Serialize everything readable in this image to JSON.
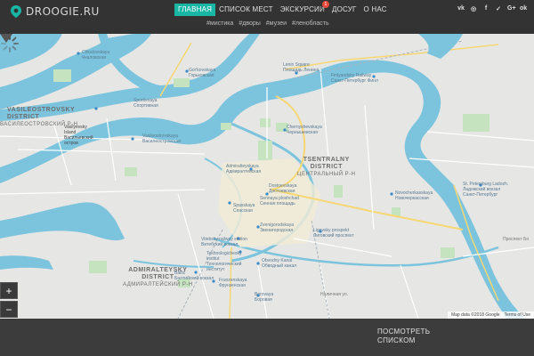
{
  "brand": {
    "name": "DROOGIE.RU",
    "accent": "#19b6a6"
  },
  "nav": {
    "items": [
      {
        "label": "ГЛАВНАЯ",
        "active": true
      },
      {
        "label": "СПИСОК МЕСТ",
        "active": false
      },
      {
        "label": "ЭКСКУРСИИ",
        "active": false,
        "badge": "1"
      },
      {
        "label": "ДОСУГ",
        "active": false
      },
      {
        "label": "О НАС",
        "active": false
      }
    ]
  },
  "tags": [
    "#мистика",
    "#дворы",
    "#музеи",
    "#ленобласть"
  ],
  "social": [
    "vk-icon",
    "instagram-icon",
    "facebook-icon",
    "twitter-icon",
    "google-plus-icon",
    "odnoklassniki-icon"
  ],
  "social_glyphs": [
    "vk",
    "◎",
    "f",
    "✓",
    "G+",
    "ok"
  ],
  "map": {
    "labels": {
      "chkalovskaya": "Chkalovskaya\nЧкаловская",
      "gorkovskaya": "Gor'kovskaya\nГорьковская",
      "lenin_square": "Lenin Square\nПлощадь Ленина",
      "finlyandsky": "Finlyandsky Railway\nСанкт-Петербург Финл",
      "sportivnaya": "Sportivnaya\nСпортивная",
      "vasileostrovsky_district": "VASILEOSTROVSKY\nDISTRICT",
      "vasileostrovsky_district_ru": "ВАСИЛЕОСТРОВСКИЙ Р-Н",
      "vasilyevsky_island": "Vasilyevsky\nIsland\nВасильевский\nостров",
      "vasileostrovskaya": "Vasileostrovskaya\nВасилеостровская",
      "chernyshevskaya": "Chernyshevskaya\nЧернышевская",
      "admiralteyskaya": "Admiralteyskaya\nАдмиралтейская",
      "dostoevskaya": "Dostoevskaya\nДостоевская",
      "sennaya": "Sennaya ploshchad\nСенная площадь",
      "tsentralny_district": "TSENTRALNY\nDISTRICT",
      "tsentralny_district_ru": "ЦЕНТРАЛЬНЫЙ Р-Н",
      "spasskaya": "Spasskaya\nСпасская",
      "zvenigorodskaya": "Zvenigorodskaya\nЗвенигородская",
      "vitebsky": "Vitebsky railway station\nВитебский вокзал",
      "tekhnologichesky": "Tekhnologichesky\ninstitut\nТехнологический\nинститут",
      "ligovsky": "Ligovsky prospekt\nЛиговский проспект",
      "obvodny": "Obvodny Kanal\nОбводный канал",
      "admiralteysky_district": "ADMIRALTEYSKY\nDISTRICT",
      "admiralteysky_district_ru": "АДМИРАЛТЕЙСКИЙ Р-Н",
      "baltic": "Baltic\nБалтийский вокзал",
      "frunzenskaya": "Frunzenskaya\nФрунзенская",
      "borovaya": "Borovaya\nБоровая",
      "novocherkasskaya": "Novocherkasskaya\nНовочеркасская",
      "ladozhsky": "St. Petersburg Ladozh.\nЛадожский вокзал\nСанкт-Петербург",
      "nevsky": "Nevsky prospekt",
      "ploshchad_alexandra": "Площадь Александра Невского",
      "prospekt_bolshevikov": "Проспект Бо",
      "nalichnaya": "Наличная ул.",
      "sredny": "Средний пр.",
      "bolshoy": "Большой пр.",
      "nevsky_pr": "Невский пр.",
      "fontanka": "наб. реки Фонтанки",
      "obvodny_nab": "наб. Обводного канала",
      "sverdlovskaya": "Свердловская наб.",
      "kamennoostrovsky": "Каменноостровский пр.",
      "primorsky": "Приморский пр.",
      "moskovsky": "Московский пр.",
      "zagorodny": "Загородный пр.",
      "sinopskaya": "Синопская наб.",
      "utkinskaya": "Уткина",
      "rechnaya": "наб. Обводного",
      "vyborgskaya": "Выборгская наб."
    },
    "zoom_in": "+",
    "zoom_out": "−",
    "attribution": [
      "Map data ©2018 Google",
      "Terms of Use"
    ]
  },
  "bottom": {
    "view_list": "ПОСМОТРЕТЬ\nСПИСКОМ"
  }
}
